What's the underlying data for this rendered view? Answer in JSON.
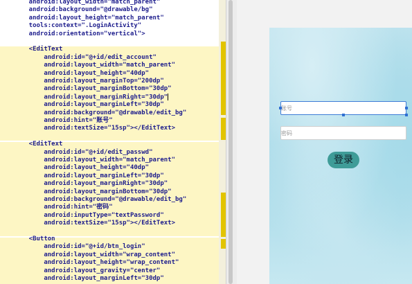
{
  "editor": {
    "lines": [
      {
        "k": "l00",
        "text": "    android:layout_width=\"match_parent\""
      },
      {
        "k": "l01",
        "text": "    android:background=\"@drawable/bg\""
      },
      {
        "k": "l02",
        "text": "    android:layout_height=\"match_parent\""
      },
      {
        "k": "l03",
        "text": "    tools:context=\".LoginActivity\""
      },
      {
        "k": "l04",
        "text": "    android:orientation=\"vertical\">"
      },
      {
        "k": "l05",
        "text": ""
      },
      {
        "k": "l06",
        "text": "    <EditText"
      },
      {
        "k": "l07",
        "text": "        android:id=\"@+id/edit_account\""
      },
      {
        "k": "l08",
        "text": "        android:layout_width=\"match_parent\""
      },
      {
        "k": "l09",
        "text": "        android:layout_height=\"40dp\""
      },
      {
        "k": "l10",
        "text": "        android:layout_marginTop=\"200dp\""
      },
      {
        "k": "l11",
        "text": "        android:layout_marginBottom=\"30dp\""
      },
      {
        "k": "l12",
        "text": "        android:layout_marginRight=\"30dp\""
      },
      {
        "k": "l13",
        "text": "        android:layout_marginLeft=\"30dp\""
      },
      {
        "k": "l14",
        "text": "        android:background=\"@drawable/edit_bg\""
      },
      {
        "k": "l15",
        "text": "        android:hint=\"账号\""
      },
      {
        "k": "l16",
        "text": "        android:textSize=\"15sp\"></EditText>"
      },
      {
        "k": "l17",
        "text": ""
      },
      {
        "k": "l18",
        "text": "    <EditText"
      },
      {
        "k": "l19",
        "text": "        android:id=\"@+id/edit_passwd\""
      },
      {
        "k": "l20",
        "text": "        android:layout_width=\"match_parent\""
      },
      {
        "k": "l21",
        "text": "        android:layout_height=\"40dp\""
      },
      {
        "k": "l22",
        "text": "        android:layout_marginLeft=\"30dp\""
      },
      {
        "k": "l23",
        "text": "        android:layout_marginRight=\"30dp\""
      },
      {
        "k": "l24",
        "text": "        android:layout_marginBottom=\"30dp\""
      },
      {
        "k": "l25",
        "text": "        android:background=\"@drawable/edit_bg\""
      },
      {
        "k": "l26",
        "text": "        android:hint=\"密码\""
      },
      {
        "k": "l27",
        "text": "        android:inputType=\"textPassword\""
      },
      {
        "k": "l28",
        "text": "        android:textSize=\"15sp\"></EditText>"
      },
      {
        "k": "l29",
        "text": ""
      },
      {
        "k": "l30",
        "text": "    <Button"
      },
      {
        "k": "l31",
        "text": "        android:id=\"@+id/btn_login\""
      },
      {
        "k": "l32",
        "text": "        android:layout_width=\"wrap_content\""
      },
      {
        "k": "l33",
        "text": "        android:layout_height=\"wrap_content\""
      },
      {
        "k": "l34",
        "text": "        android:layout_gravity=\"center\""
      },
      {
        "k": "l35",
        "text": "        android:layout_marginLeft=\"30dp\""
      }
    ]
  },
  "preview": {
    "account_hint": "账号",
    "passwd_hint": "密码",
    "login_label": "登录"
  },
  "colors": {
    "highlight": "#fdf6c4",
    "gutter_mark": "#e2c400",
    "selection": "#3c7bd6",
    "login_button": "#3f9c98"
  }
}
